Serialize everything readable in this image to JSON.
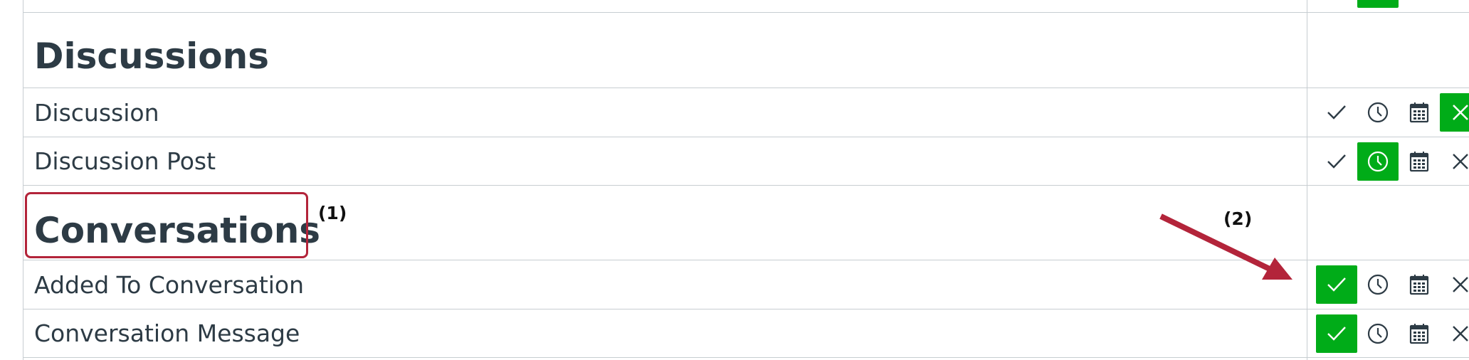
{
  "sections": [
    {
      "title": "Discussions",
      "rows": [
        {
          "label": "Discussion",
          "selected": "never"
        },
        {
          "label": "Discussion Post",
          "selected": "daily"
        }
      ]
    },
    {
      "title": "Conversations",
      "rows": [
        {
          "label": "Added To Conversation",
          "selected": "immediately"
        },
        {
          "label": "Conversation Message",
          "selected": "immediately"
        }
      ]
    }
  ],
  "annotations": {
    "callout_1": "(1)",
    "callout_2": "(2)"
  },
  "colors": {
    "selected": "#00ac18",
    "highlight": "#b3243a",
    "text": "#2d3b45",
    "border": "#c7cdd1"
  },
  "icons": {
    "immediately": "checkmark-icon",
    "daily": "clock-icon",
    "weekly": "calendar-icon",
    "never": "x-icon"
  }
}
